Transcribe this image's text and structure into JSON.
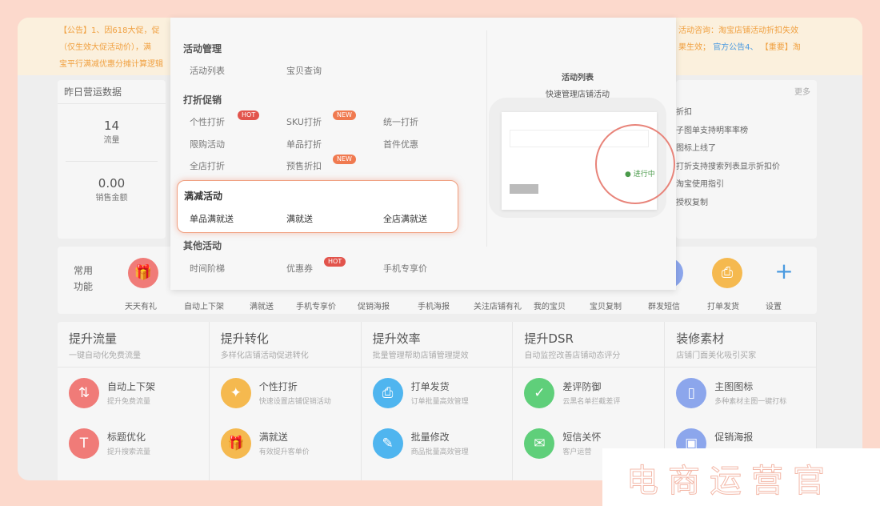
{
  "banner": {
    "line1": "【公告】1、因618大促，促",
    "line1b": "活动咨询：淘宝店铺活动折扣失效",
    "line2": "（仅生效大促活动价），满",
    "line2b": "果生效；",
    "link": "官方公告4、",
    "line2c": "【重要】淘",
    "line3": "宝平行满减优惠分摊计算逻辑"
  },
  "yesterday": {
    "title": "昨日营运数据",
    "stats": [
      {
        "value": "14",
        "label": "流量"
      },
      {
        "value": "0.00",
        "label": "销售金额"
      }
    ]
  },
  "news": {
    "more": "更多",
    "items": [
      "折扣",
      "子图单支持明率率榜",
      "图标上线了",
      "打折支持搜索列表显示折扣价",
      "淘宝使用指引",
      "授权复制"
    ]
  },
  "dropdown": {
    "sections": [
      {
        "title": "活动管理",
        "items": [
          "活动列表",
          "宝贝查询"
        ]
      },
      {
        "title": "打折促销",
        "items": [
          "个性打折",
          "SKU打折",
          "统一打折",
          "限购活动",
          "单品打折",
          "首件优惠",
          "全店打折",
          "预售折扣"
        ]
      },
      {
        "title": "满减活动",
        "items": [
          "单品满就送",
          "满就送",
          "全店满就送"
        ]
      },
      {
        "title": "其他活动",
        "items": [
          "时间阶梯",
          "优惠券",
          "手机专享价"
        ]
      }
    ],
    "badges": {
      "hot": "HOT",
      "new": "NEW"
    },
    "preview": {
      "title": "活动列表",
      "subtitle": "快速管理店铺活动",
      "status": "进行中"
    }
  },
  "common": {
    "title": "常用功能",
    "items": [
      "天天有礼",
      "自动上下架",
      "满就送",
      "手机专享价",
      "促销海报",
      "手机海报",
      "关注店铺有礼",
      "我的宝贝",
      "宝贝复制",
      "群发短信",
      "打单发货",
      "设置"
    ]
  },
  "grid": [
    {
      "title": "提升流量",
      "sub": "一键自动化免费流量",
      "items": [
        {
          "name": "自动上下架",
          "desc": "提升免费流量",
          "color": "#f07b78",
          "icon": "⇅"
        },
        {
          "name": "标题优化",
          "desc": "提升搜索流量",
          "color": "#f07b78",
          "icon": "T"
        }
      ]
    },
    {
      "title": "提升转化",
      "sub": "多样化店铺活动促进转化",
      "items": [
        {
          "name": "个性打折",
          "desc": "快速设置店铺促销活动",
          "color": "#f5b94f",
          "icon": "✦"
        },
        {
          "name": "满就送",
          "desc": "有效提升客单价",
          "color": "#f5b94f",
          "icon": "🎁"
        }
      ]
    },
    {
      "title": "提升效率",
      "sub": "批量管理帮助店铺管理提效",
      "items": [
        {
          "name": "打单发货",
          "desc": "订单批量高效管理",
          "color": "#4fb5ef",
          "icon": "⎙"
        },
        {
          "name": "批量修改",
          "desc": "商品批量高效管理",
          "color": "#4fb5ef",
          "icon": "✎"
        }
      ]
    },
    {
      "title": "提升DSR",
      "sub": "自动监控改善店铺动态评分",
      "items": [
        {
          "name": "差评防御",
          "desc": "云黑名单拦截差评",
          "color": "#5fcf7a",
          "icon": "✓"
        },
        {
          "name": "短信关怀",
          "desc": "客户运营",
          "color": "#5fcf7a",
          "icon": "✉"
        }
      ]
    },
    {
      "title": "装修素材",
      "sub": "店铺门面美化吸引买家",
      "items": [
        {
          "name": "主图图标",
          "desc": "多种素材主图一键打标",
          "color": "#8ca6ec",
          "icon": "▯"
        },
        {
          "name": "促销海报",
          "desc": "",
          "color": "#8ca6ec",
          "icon": "▣"
        }
      ]
    }
  ],
  "watermark": "电商运营官",
  "colors": {
    "frame": "#fcd9cc",
    "accent": "#e2544c",
    "highlight_border": "#f0a080"
  }
}
